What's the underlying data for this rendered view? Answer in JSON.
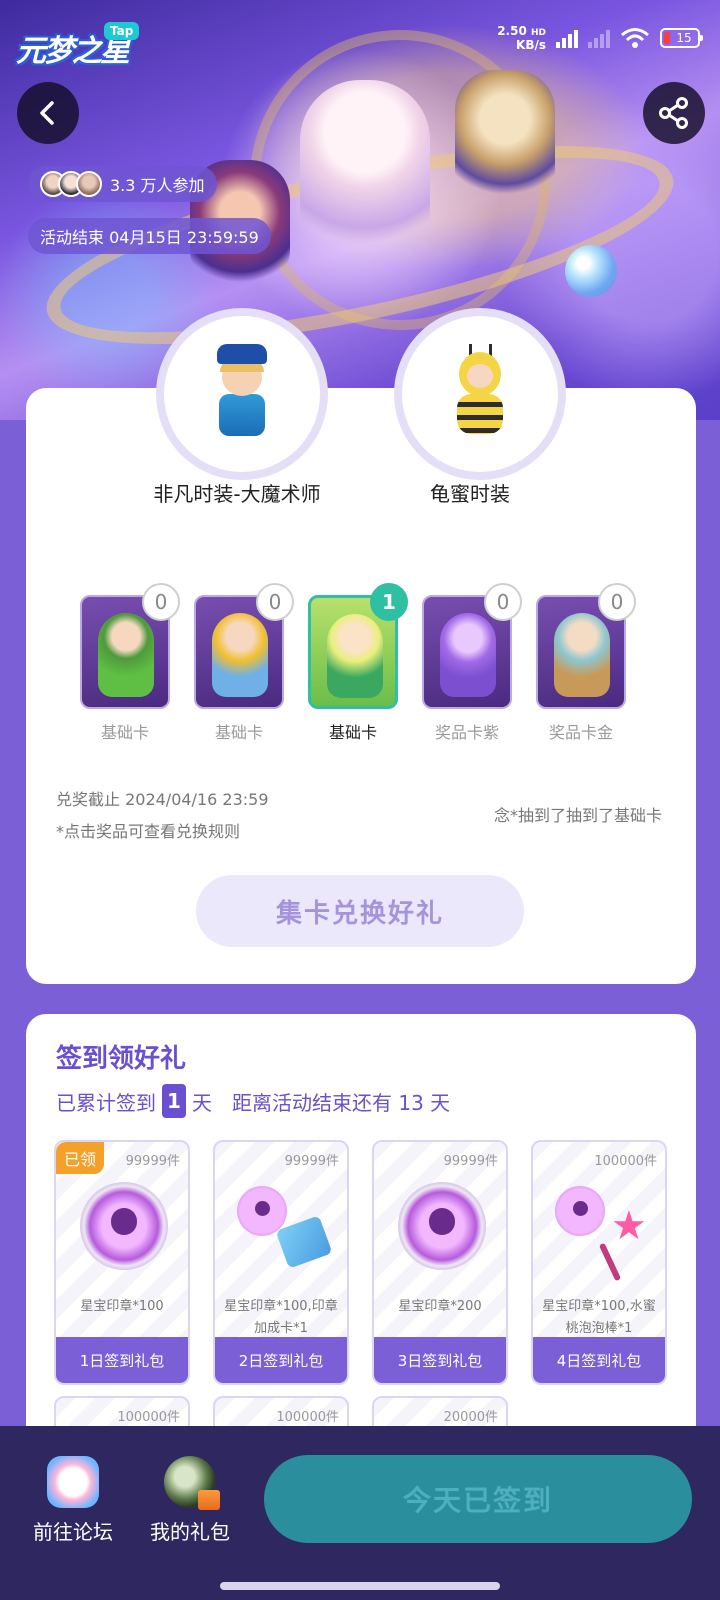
{
  "status_bar": {
    "network_speed_top": "2.50",
    "network_speed_bottom": "KB/s",
    "hd_label": "HD",
    "battery": "15"
  },
  "app_logo": {
    "text": "元梦之星",
    "badge": "Tap"
  },
  "header": {
    "participants": "3.3 万人参加",
    "end_time": "活动结束 04月15日 23:59:59"
  },
  "prizes": [
    {
      "name": "非凡时装-大魔术师"
    },
    {
      "name": "龟蜜时装"
    }
  ],
  "cards": [
    {
      "label": "基础卡",
      "count": "0",
      "active": false
    },
    {
      "label": "基础卡",
      "count": "0",
      "active": false
    },
    {
      "label": "基础卡",
      "count": "1",
      "active": true
    },
    {
      "label": "奖品卡紫",
      "count": "0",
      "active": false
    },
    {
      "label": "奖品卡金",
      "count": "0",
      "active": false
    }
  ],
  "redeem": {
    "deadline": "兑奖截止 2024/04/16 23:59",
    "rule_tip": "*点击奖品可查看兑换规则",
    "ticker": "念*抽到了抽到了基础卡",
    "button": "集卡兑换好礼"
  },
  "checkin": {
    "title": "签到领好礼",
    "prefix": "已累计签到",
    "days": "1",
    "suffix": "天",
    "remaining": "距离活动结束还有 13 天",
    "gifts": [
      {
        "stock": "99999件",
        "desc": "星宝印章*100",
        "footer": "1日签到礼包",
        "claimed": "已领"
      },
      {
        "stock": "99999件",
        "desc": "星宝印章*100,印章加成卡*1",
        "footer": "2日签到礼包"
      },
      {
        "stock": "99999件",
        "desc": "星宝印章*200",
        "footer": "3日签到礼包"
      },
      {
        "stock": "100000件",
        "desc": "星宝印章*100,水蜜桃泡泡棒*1",
        "footer": "4日签到礼包"
      },
      {
        "stock": "100000件"
      },
      {
        "stock": "100000件"
      },
      {
        "stock": "20000件"
      }
    ]
  },
  "bottom_nav": {
    "forum": "前往论坛",
    "my_gifts": "我的礼包",
    "signed_button": "今天已签到"
  },
  "colors": {
    "accent": "#6a4fd0",
    "background": "#7b5fd6",
    "claimed_badge": "#f4a12b",
    "active_card": "#2fc0a4",
    "bottom_bar": "#2f2760"
  }
}
